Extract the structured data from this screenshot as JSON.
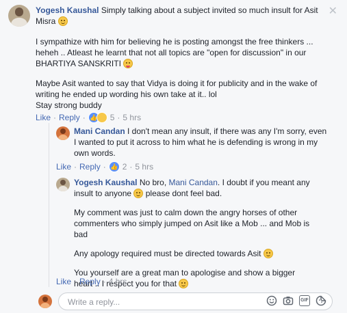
{
  "close_glyph": "✕",
  "comment1": {
    "author": "Yogesh Kaushal",
    "intro": "Simply talking about a subject invited so much insult for Asit Misra",
    "para1": "I sympathize with him for believing he is posting amongst the free thinkers ... heheh .. Atleast he learnt that not all topics are \"open for discussion\" in our BHARTIYA SANSKRITI",
    "para2a": "Maybe Asit wanted to say that Vidya is doing it for publicity and in the wake of writing he ended up wording his own take at it.. lol",
    "para2b": "Stay strong buddy",
    "like": "Like",
    "reply": "Reply",
    "reactions": "5",
    "time": "5 hrs"
  },
  "comment2": {
    "author": "Mani Candan",
    "text": "I don't mean any insult, if there was any I'm sorry, even I wanted to put it across to him what he is defending is wrong in my own words.",
    "like": "Like",
    "reply": "Reply",
    "reactions": "2",
    "time": "5 hrs"
  },
  "comment3": {
    "author": "Yogesh Kaushal",
    "intro1": "No bro,",
    "mention": "Mani Candan",
    "intro2": ". I doubt if you meant any insult to anyone",
    "intro3": "please dont feel bad.",
    "para1": "My comment was just to calm down the angry horses of other commenters who simply jumped on Asit like a Mob ... and Mob is bad",
    "para2": "Any apology required must be directed towards Asit",
    "para3": "You yourself are a great man to apologise and show a bigger heart .. I respect you for that",
    "like": "Like",
    "reply": "Reply",
    "time": "4 hrs"
  },
  "reply_box": {
    "placeholder": "Write a reply...",
    "icons": [
      "emoji-icon",
      "camera-icon",
      "gif-icon",
      "sticker-icon"
    ],
    "gif_label": "GIF"
  },
  "colors": {
    "link": "#365899",
    "action": "#4267b2",
    "meta": "#90949c",
    "like": "#5890ff"
  }
}
